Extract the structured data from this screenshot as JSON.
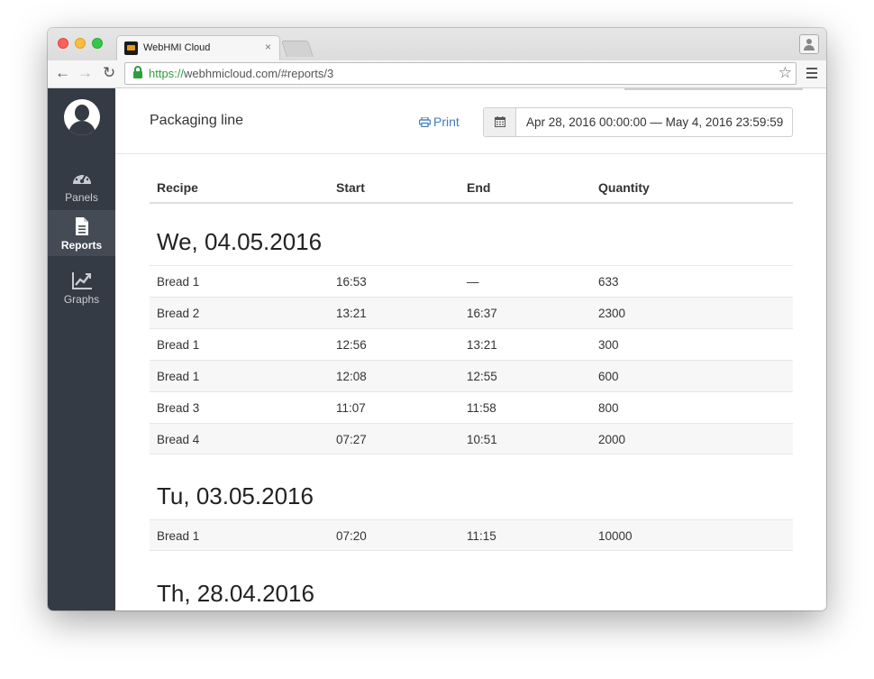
{
  "browser": {
    "tab_title": "WebHMI Cloud",
    "tab_close": "×",
    "url_scheme": "https://",
    "url_rest": "webhmicloud.com/#reports/3"
  },
  "sidebar": {
    "items": [
      {
        "label": "Panels",
        "icon": "gauge-icon"
      },
      {
        "label": "Reports",
        "icon": "document-icon"
      },
      {
        "label": "Graphs",
        "icon": "line-chart-icon"
      }
    ]
  },
  "header": {
    "title": "Packaging line",
    "print_label": "Print",
    "date_range": "Apr 28, 2016 00:00:00 — May 4, 2016 23:59:59"
  },
  "table": {
    "columns": [
      "Recipe",
      "Start",
      "End",
      "Quantity"
    ],
    "groups": [
      {
        "date": "We, 04.05.2016",
        "rows": [
          [
            "Bread 1",
            "16:53",
            "—",
            "633"
          ],
          [
            "Bread 2",
            "13:21",
            "16:37",
            "2300"
          ],
          [
            "Bread 1",
            "12:56",
            "13:21",
            "300"
          ],
          [
            "Bread 1",
            "12:08",
            "12:55",
            "600"
          ],
          [
            "Bread 3",
            "11:07",
            "11:58",
            "800"
          ],
          [
            "Bread 4",
            "07:27",
            "10:51",
            "2000"
          ]
        ]
      },
      {
        "date": "Tu, 03.05.2016",
        "rows": [
          [
            "Bread 1",
            "07:20",
            "11:15",
            "10000"
          ]
        ]
      },
      {
        "date": "Th, 28.04.2016",
        "rows": []
      }
    ]
  },
  "colors": {
    "sidebar_bg": "#353b44",
    "sidebar_active": "#444b55",
    "link": "#3d7fc1",
    "secure_green": "#2e9e3e"
  }
}
